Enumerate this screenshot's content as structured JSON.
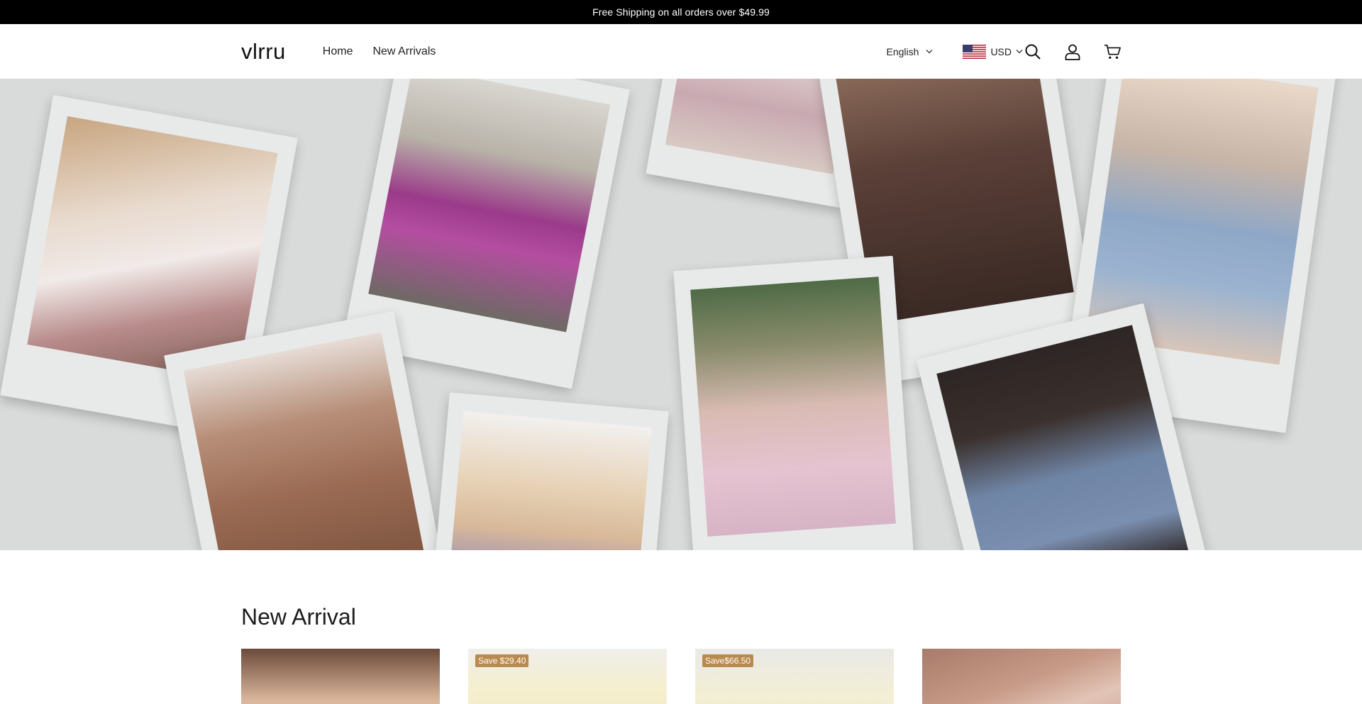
{
  "announcement": {
    "text": "Free Shipping on all orders over $49.99"
  },
  "header": {
    "logo": "vlrru",
    "nav": [
      {
        "label": "Home"
      },
      {
        "label": "New Arrivals"
      }
    ],
    "language": "English",
    "currency": "USD",
    "icons": [
      "search-icon",
      "account-icon",
      "cart-icon"
    ]
  },
  "hero": {
    "background": "#d9dada",
    "polaroid_frame_color": "#e8eaea"
  },
  "new_arrival": {
    "title": "New Arrival",
    "products": [
      {
        "badge": ""
      },
      {
        "badge": "Save $29.40"
      },
      {
        "badge": "Save$66.50"
      },
      {
        "badge": ""
      }
    ]
  },
  "colors": {
    "announcement_bg": "#000000",
    "badge_bg": "#b98a4f"
  }
}
